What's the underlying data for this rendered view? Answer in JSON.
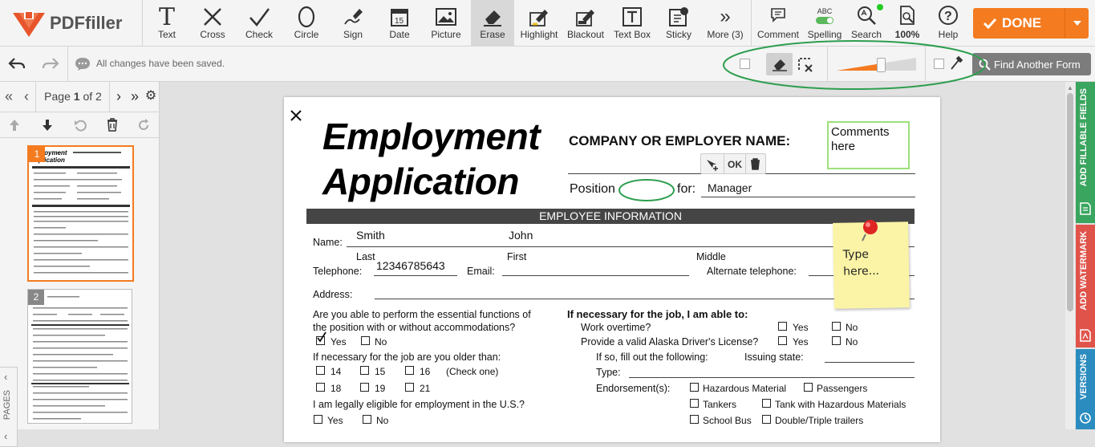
{
  "app": {
    "logo_text": "PDFfiller"
  },
  "toolbar": {
    "tools": [
      {
        "label": "Text"
      },
      {
        "label": "Cross"
      },
      {
        "label": "Check"
      },
      {
        "label": "Circle"
      },
      {
        "label": "Sign"
      },
      {
        "label": "Date"
      },
      {
        "label": "Picture"
      },
      {
        "label": "Erase"
      },
      {
        "label": "Highlight"
      },
      {
        "label": "Blackout"
      },
      {
        "label": "Text Box"
      },
      {
        "label": "Sticky"
      },
      {
        "label": "More (3)"
      }
    ],
    "right_tools": [
      {
        "label": "Comment"
      },
      {
        "label": "Spelling"
      },
      {
        "label": "Search"
      },
      {
        "label": "100%"
      },
      {
        "label": "Help"
      }
    ],
    "spelling_abc": "ABC",
    "done_label": "DONE"
  },
  "subbar": {
    "status": "All changes have been saved.",
    "find_label": "Find Another Form"
  },
  "pagenav": {
    "page_prefix": "Page",
    "page_current": "1",
    "page_of": "of 2"
  },
  "thumbnails": [
    {
      "num": "1"
    },
    {
      "num": "2"
    }
  ],
  "side_tabs": {
    "pages": "PAGES",
    "fillable": "ADD FILLABLE FIELDS",
    "watermark": "ADD WATERMARK",
    "versions": "VERSIONS"
  },
  "colors": {
    "accent": "#f47b20",
    "green": "#2e9e4f",
    "fillable_tab": "#3aa55e",
    "watermark_tab": "#e0534a",
    "versions_tab": "#2b8cbf"
  },
  "document": {
    "title_line1": "Employment",
    "title_line2": "Application",
    "company_label": "COMPANY OR EMPLOYER NAME:",
    "comment_box": "Comments here",
    "position_label": "Position",
    "for_label": "for:",
    "position_value": "Manager",
    "mini_ok": "OK",
    "section_header": "EMPLOYEE INFORMATION",
    "name_label": "Name:",
    "last_value": "Smith",
    "first_value": "John",
    "last_label": "Last",
    "first_label": "First",
    "middle_label": "Middle",
    "telephone_label": "Telephone:",
    "telephone_value": "12346785643",
    "email_label": "Email:",
    "alt_phone_label": "Alternate telephone:",
    "address_label": "Address:",
    "sticky_text": "Type here...",
    "q_essential_1": "Are you able to perform the essential functions of",
    "q_essential_2": "the position with or without accommodations?",
    "yes": "Yes",
    "no": "No",
    "q_older": "If necessary for the job are you older than:",
    "ages": [
      "14",
      "15",
      "16",
      "18",
      "19",
      "21"
    ],
    "check_one": "(Check one)",
    "q_eligible": "I am legally eligible for employment in the U.S.?",
    "q_able": "If necessary for the job, I am able to:",
    "q_overtime": "Work overtime?",
    "q_license": "Provide a valid Alaska Driver's License?",
    "q_fill": "If so, fill out the following:",
    "issuing_state": "Issuing state:",
    "type_label": "Type:",
    "endorsements_label": "Endorsement(s):",
    "endorsements": [
      "Hazardous Material",
      "Passengers",
      "Tankers",
      "Tank with Hazardous Materials",
      "School Bus",
      "Double/Triple trailers"
    ]
  }
}
